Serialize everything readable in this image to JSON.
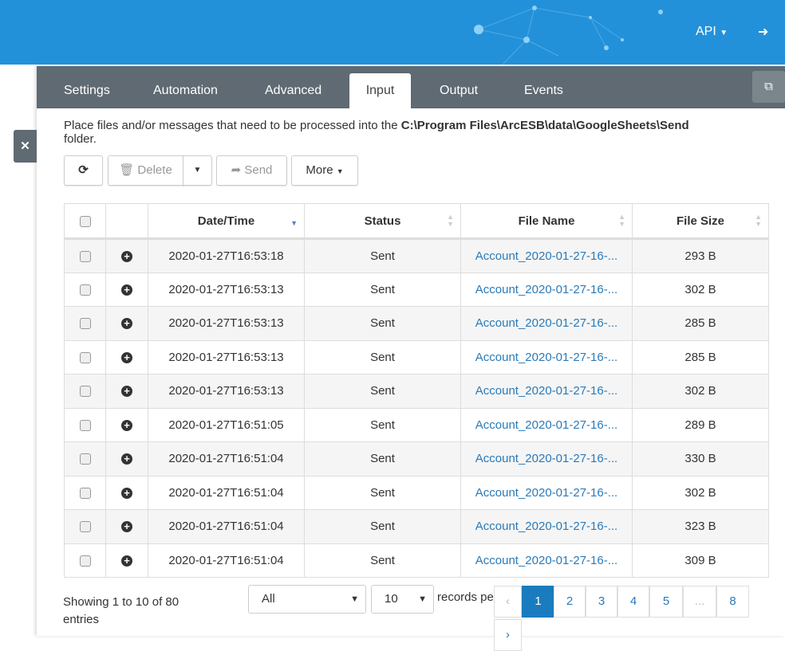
{
  "header": {
    "api_label": "API",
    "logout_icon": "sign-out-icon"
  },
  "tabs": [
    {
      "label": "Settings"
    },
    {
      "label": "Automation"
    },
    {
      "label": "Advanced"
    },
    {
      "label": "Input"
    },
    {
      "label": "Output"
    },
    {
      "label": "Events"
    }
  ],
  "description": {
    "prefix": "Place files and/or messages that need to be processed into the ",
    "path": "C:\\Program Files\\ArcESB\\data\\GoogleSheets\\Send",
    "suffix": "folder."
  },
  "toolbar": {
    "refresh": "⟳",
    "delete": "Delete",
    "send": "Send",
    "more": "More"
  },
  "table": {
    "headers": [
      "Date/Time",
      "Status",
      "File Name",
      "File Size"
    ],
    "rows": [
      [
        "2020-01-27T16:53:18",
        "Sent",
        "Account_2020-01-27-16-...",
        "293 B"
      ],
      [
        "2020-01-27T16:53:13",
        "Sent",
        "Account_2020-01-27-16-...",
        "302 B"
      ],
      [
        "2020-01-27T16:53:13",
        "Sent",
        "Account_2020-01-27-16-...",
        "285 B"
      ],
      [
        "2020-01-27T16:53:13",
        "Sent",
        "Account_2020-01-27-16-...",
        "285 B"
      ],
      [
        "2020-01-27T16:53:13",
        "Sent",
        "Account_2020-01-27-16-...",
        "302 B"
      ],
      [
        "2020-01-27T16:51:05",
        "Sent",
        "Account_2020-01-27-16-...",
        "289 B"
      ],
      [
        "2020-01-27T16:51:04",
        "Sent",
        "Account_2020-01-27-16-...",
        "330 B"
      ],
      [
        "2020-01-27T16:51:04",
        "Sent",
        "Account_2020-01-27-16-...",
        "302 B"
      ],
      [
        "2020-01-27T16:51:04",
        "Sent",
        "Account_2020-01-27-16-...",
        "323 B"
      ],
      [
        "2020-01-27T16:51:04",
        "Sent",
        "Account_2020-01-27-16-...",
        "309 B"
      ]
    ]
  },
  "footer": {
    "showing": "Showing 1 to 10 of 80 entries",
    "filter": "All",
    "page_size": "10",
    "records_label": "records per page",
    "pages": [
      "‹",
      "1",
      "2",
      "3",
      "4",
      "5",
      "...",
      "8",
      "›"
    ]
  }
}
